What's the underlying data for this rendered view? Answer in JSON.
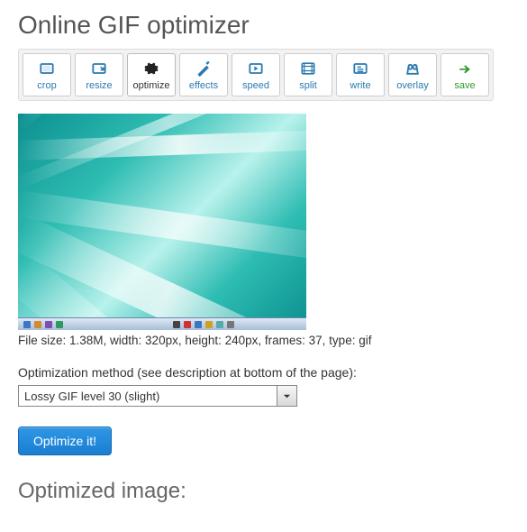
{
  "page_title": "Online GIF optimizer",
  "toolbar": {
    "items": [
      {
        "id": "crop",
        "label": "crop"
      },
      {
        "id": "resize",
        "label": "resize"
      },
      {
        "id": "optimize",
        "label": "optimize"
      },
      {
        "id": "effects",
        "label": "effects"
      },
      {
        "id": "speed",
        "label": "speed"
      },
      {
        "id": "split",
        "label": "split"
      },
      {
        "id": "write",
        "label": "write"
      },
      {
        "id": "overlay",
        "label": "overlay"
      },
      {
        "id": "save",
        "label": "save"
      }
    ]
  },
  "file_info": "File size: 1.38M, width: 320px, height: 240px, frames: 37, type: gif",
  "method_label": "Optimization method (see description at bottom of the page):",
  "method_selected": "Lossy GIF level 30 (slight)",
  "optimize_button": "Optimize it!",
  "optimized_heading": "Optimized image:"
}
